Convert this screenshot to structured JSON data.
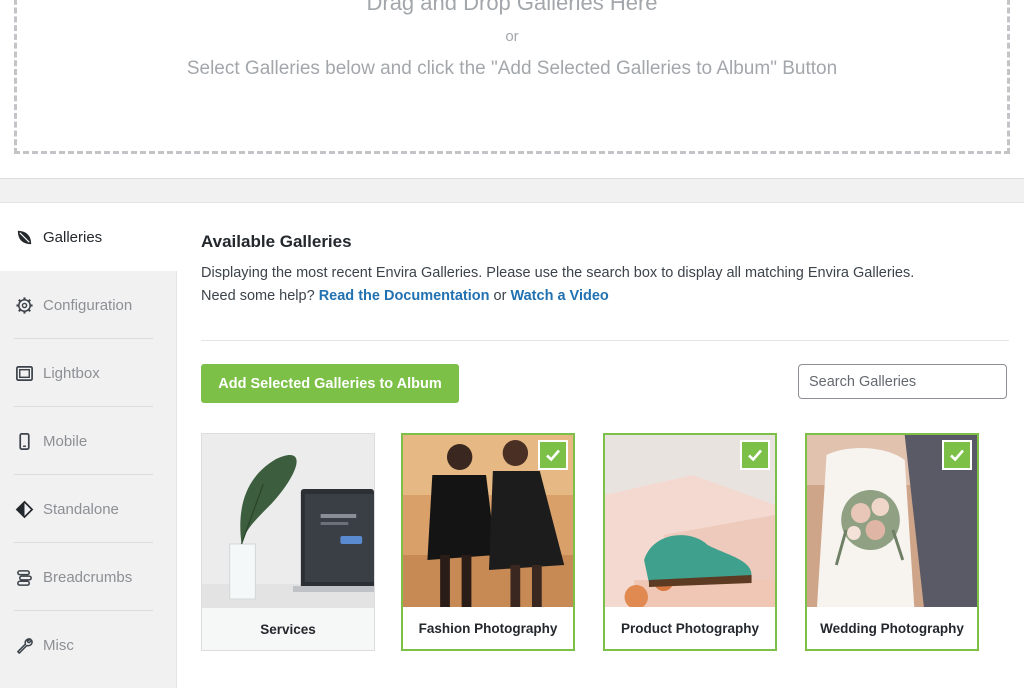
{
  "dropzone": {
    "title": "Drag and Drop Galleries Here",
    "or": "or",
    "subtitle": "Select Galleries below and click the \"Add Selected Galleries to Album\" Button"
  },
  "sidebar": {
    "items": [
      {
        "label": "Galleries",
        "icon": "leaf-icon",
        "active": true
      },
      {
        "label": "Configuration",
        "icon": "gear-icon"
      },
      {
        "label": "Lightbox",
        "icon": "lightbox-icon"
      },
      {
        "label": "Mobile",
        "icon": "mobile-icon"
      },
      {
        "label": "Standalone",
        "icon": "diamond-icon"
      },
      {
        "label": "Breadcrumbs",
        "icon": "breadcrumbs-icon"
      },
      {
        "label": "Misc",
        "icon": "wrench-icon"
      }
    ]
  },
  "main": {
    "title": "Available Galleries",
    "description": "Displaying the most recent Envira Galleries. Please use the search box to display all matching Envira Galleries.",
    "help_prefix": "Need some help?",
    "doc_link": "Read the Documentation",
    "or_text": "or",
    "video_link": "Watch a Video",
    "add_button": "Add Selected Galleries to Album",
    "search_placeholder": "Search Galleries"
  },
  "galleries": [
    {
      "title": "Services",
      "selected": false
    },
    {
      "title": "Fashion Photography",
      "selected": true
    },
    {
      "title": "Product Photography",
      "selected": true
    },
    {
      "title": "Wedding Photography",
      "selected": true
    }
  ],
  "colors": {
    "accent": "#7cc048",
    "link": "#2271b1",
    "muted": "#a3a7ab"
  }
}
